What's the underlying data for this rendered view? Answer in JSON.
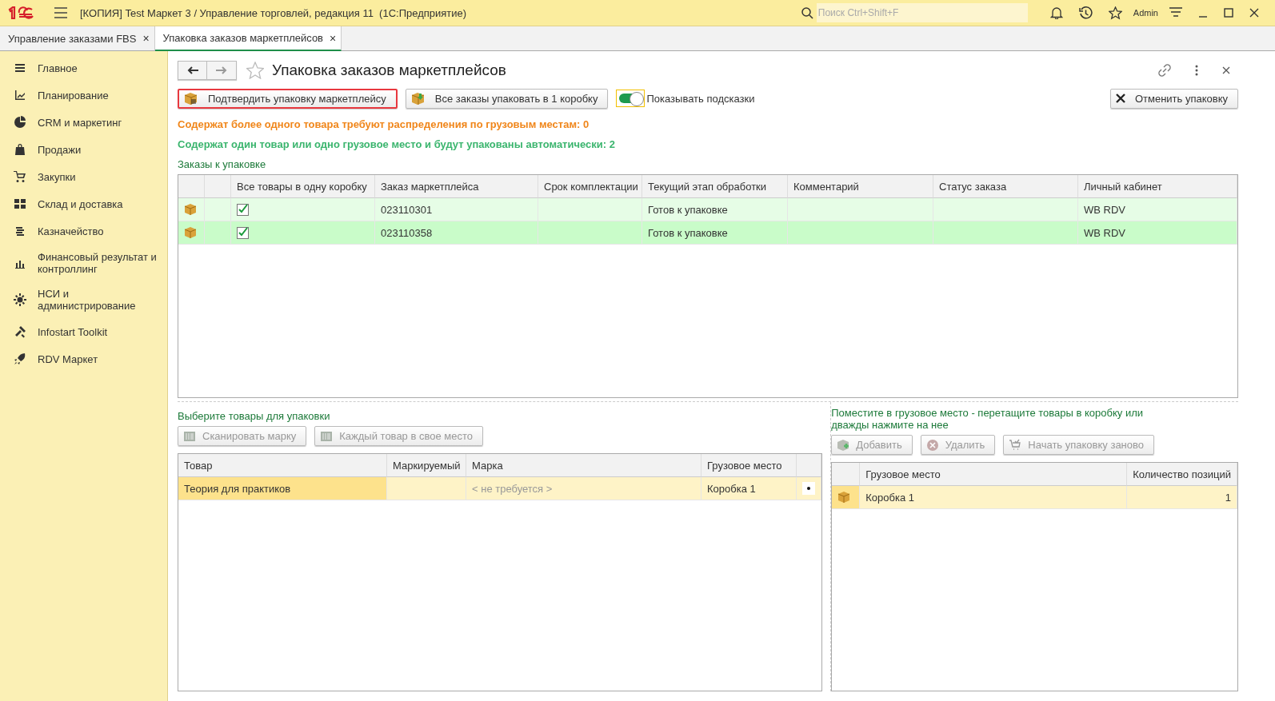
{
  "window": {
    "title": "[КОПИЯ] Test Маркет 3 / Управление торговлей, редакция 11  (1С:Предприятие)",
    "search_placeholder": "Поиск Ctrl+Shift+F",
    "user": "Admin"
  },
  "tabs": [
    {
      "label": "Управление заказами FBS",
      "close": "×",
      "selected": false
    },
    {
      "label": "Упаковка заказов маркетплейсов",
      "close": "×",
      "selected": true
    }
  ],
  "sidebar": {
    "items": [
      {
        "label": "Главное"
      },
      {
        "label": "Планирование"
      },
      {
        "label": "CRM и маркетинг"
      },
      {
        "label": "Продажи"
      },
      {
        "label": "Закупки"
      },
      {
        "label": "Склад и доставка"
      },
      {
        "label": "Казначейство"
      },
      {
        "label": "Финансовый результат и контроллинг"
      },
      {
        "label": "НСИ и администрирование"
      },
      {
        "label": "Infostart Toolkit"
      },
      {
        "label": "RDV Маркет"
      }
    ]
  },
  "form": {
    "title": "Упаковка заказов маркетплейсов",
    "toolbar": [
      {
        "label": "Подтвердить упаковку маркетплейсу",
        "highlighted": true
      },
      {
        "label": "Все заказы упаковать в 1 коробку",
        "highlighted": false
      }
    ],
    "hints_toggle": {
      "label": "Показывать подсказки",
      "on": true
    },
    "cancel_button": "Отменить упаковку",
    "info_lines": [
      {
        "text": "Содержат более одного товара требуют распределения по грузовым местам: 0",
        "color": "#f0861a"
      },
      {
        "text": "Содержат один товар или одно грузовое место и будут упакованы автоматически: 2",
        "color": "#3bb56e"
      }
    ],
    "orders": {
      "title": "Заказы к упаковке",
      "columns": [
        "Все товары в одну коробку",
        "Заказ маркетплейса",
        "Срок комплектации",
        "Текущий этап обработки",
        "Комментарий",
        "Статус заказа",
        "Личный кабинет"
      ],
      "rows": [
        {
          "checked": true,
          "order": "023110301",
          "stage": "Готов к упаковке",
          "account": "WB RDV",
          "selected": false
        },
        {
          "checked": true,
          "order": "023110358",
          "stage": "Готов к упаковке",
          "account": "WB RDV",
          "selected": true
        }
      ]
    },
    "goods": {
      "title": "Выберите товары для упаковки",
      "buttons": [
        {
          "label": "Сканировать марку",
          "disabled": true
        },
        {
          "label": "Каждый товар в свое место",
          "disabled": true
        }
      ],
      "columns": [
        "Товар",
        "Маркируемый",
        "Марка",
        "Грузовое место"
      ],
      "rows": [
        {
          "product": "Теория для практиков",
          "mark": "< не требуется >",
          "place": "Коробка 1",
          "selected": true
        }
      ]
    },
    "places": {
      "title": "Поместите в грузовое место - перетащите товары в коробку или дважды нажмите на нее",
      "buttons": [
        {
          "label": "Добавить",
          "disabled": true
        },
        {
          "label": "Удалить",
          "disabled": true
        },
        {
          "label": "Начать упаковку заново",
          "disabled": true
        }
      ],
      "columns": [
        "Грузовое место",
        "Количество позиций"
      ],
      "rows": [
        {
          "place": "Коробка 1",
          "count": "1",
          "selected": true
        }
      ]
    }
  }
}
